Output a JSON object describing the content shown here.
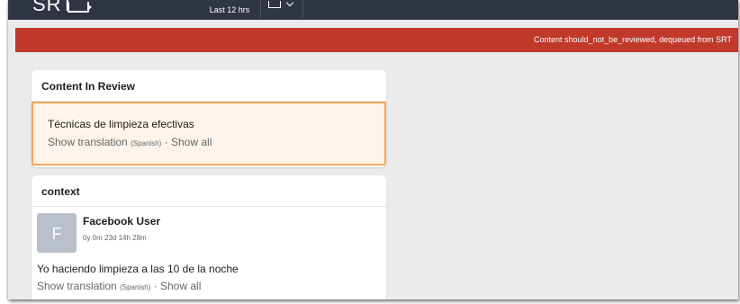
{
  "header": {
    "logo_text": "SRT",
    "time_range": "Last 12 hrs"
  },
  "alert": {
    "message": "Content should_not_be_reviewed, dequeued from SRT",
    "color": "#c0392b"
  },
  "review_card": {
    "title": "Content In Review",
    "content_text": "Técnicas de limpieza efectivas",
    "show_translation": "Show translation",
    "language": "(Spanish)",
    "separator": "·",
    "show_all": "Show all"
  },
  "context_card": {
    "title": "context",
    "avatar_initial": "F",
    "user_name": "Facebook User",
    "account_age": "0y 0m 23d 14h 28m",
    "post_text": "Yo haciendo limpieza a las 10 de la noche",
    "show_translation": "Show translation",
    "language": "(Spanish)",
    "separator": "·",
    "show_all": "Show all"
  },
  "icons": {
    "logo": "video-player-icon",
    "calendar": "calendar-icon",
    "dropdown": "chevron-down-icon"
  }
}
